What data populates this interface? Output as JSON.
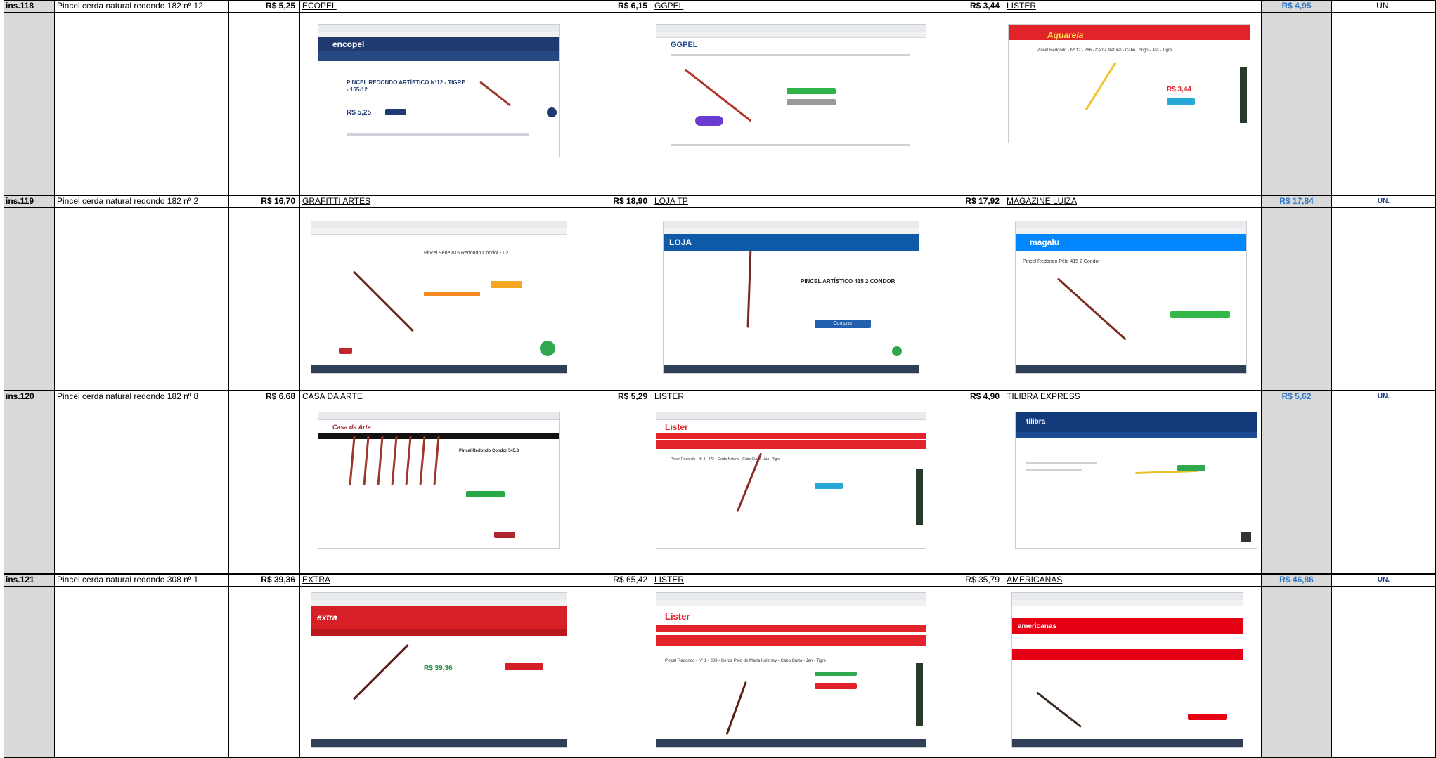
{
  "rows": [
    {
      "id": "ins.118",
      "description": "Pincel cerda natural redondo  182 nº 12",
      "price": "R$ 5,25",
      "stores": [
        {
          "name": "ECOPEL",
          "price": "R$ 6,15",
          "shot": {
            "brand": "encopel",
            "title": "PINCEL REDONDO ARTÍSTICO Nº12 - TIGRE - 165-12",
            "price": "R$ 5,25"
          }
        },
        {
          "name": "GGPEL",
          "price": "R$ 3,44",
          "shot": {
            "brand": "GGPEL",
            "title": "",
            "price": ""
          }
        },
        {
          "name": "LISTER",
          "price": "",
          "shot": {
            "brand": "Aquarela",
            "title": "Pincel Redondo - Nº 12 - 266 - Cerda Natural - Cabo Longo - Jan - Tigre",
            "price": "R$ 3,44"
          }
        }
      ],
      "average": "R$ 4,95",
      "unit": "UN."
    },
    {
      "id": "ins.119",
      "description": "Pincel cerda natural redondo  182 nº 2",
      "price": "R$ 16,70",
      "stores": [
        {
          "name": "GRAFITTI ARTES",
          "price": "R$ 18,90",
          "shot": {
            "brand": "",
            "title": "Pincel Série 815 Redondo Condor - 02",
            "price": ""
          }
        },
        {
          "name": "LOJA TP",
          "price": "R$ 17,92",
          "shot": {
            "brand": "LOJA",
            "title": "PINCEL ARTÍSTICO 415 2 CONDOR",
            "price": "Comprar"
          }
        },
        {
          "name": "MAGAZINE LUIZA",
          "price": "",
          "shot": {
            "brand": "magalu",
            "title": "Pincel Redondo Pêlo 415 2 Condor",
            "price": ""
          }
        }
      ],
      "average": "R$ 17,84",
      "unit": "UN."
    },
    {
      "id": "ins.120",
      "description": "Pincel cerda natural redondo  182 nº 8",
      "price": "R$ 6,68",
      "stores": [
        {
          "name": "CASA DA ARTE",
          "price": "R$ 5,29",
          "shot": {
            "brand": "Casa da Arte",
            "title": "Pincel Redondo Condor 545.8",
            "price": ""
          }
        },
        {
          "name": "LISTER",
          "price": "R$ 4,90",
          "shot": {
            "brand": "Lister",
            "title": "Pincel Redondo - Nº 8 - 375 - Cerda Natural - Cabo Curto - Jan - Tigre",
            "price": ""
          }
        },
        {
          "name": "TILIBRA EXPRESS",
          "price": "",
          "shot": {
            "brand": "tilibra",
            "title": "",
            "price": ""
          }
        }
      ],
      "average": "R$ 5,62",
      "unit": "UN."
    },
    {
      "id": "ins.121",
      "description": "Pincel cerda natural redondo  308 nº 1",
      "price": "R$ 39,36",
      "stores": [
        {
          "name": "EXTRA",
          "price": "R$ 65,42",
          "shot": {
            "brand": "extra",
            "title": "",
            "price": "R$ 39,36"
          }
        },
        {
          "name": "LISTER",
          "price": "R$ 35,79",
          "shot": {
            "brand": "Lister",
            "title": "Pincel Redondo - Nº 1 - 308 - Cerda Pelo de Marta Kolinsky - Cabo Curto - Jan - Tigre",
            "price": ""
          }
        },
        {
          "name": "AMERICANAS",
          "price": "",
          "shot": {
            "brand": "americanas",
            "title": "",
            "price": ""
          }
        }
      ],
      "average": "R$ 46,86",
      "unit": "UN."
    }
  ],
  "colors": {
    "grey": "#d9d9d9",
    "avg_blue": "#2f78c5",
    "encopel": "#1e3a6e",
    "lister_red": "#e2232a",
    "magalu_blue": "#0086ff",
    "extra_red": "#d61f26",
    "tilibra": "#123a7a"
  },
  "icons": [
    "brush-icon",
    "cart-icon",
    "windows-taskbar"
  ]
}
